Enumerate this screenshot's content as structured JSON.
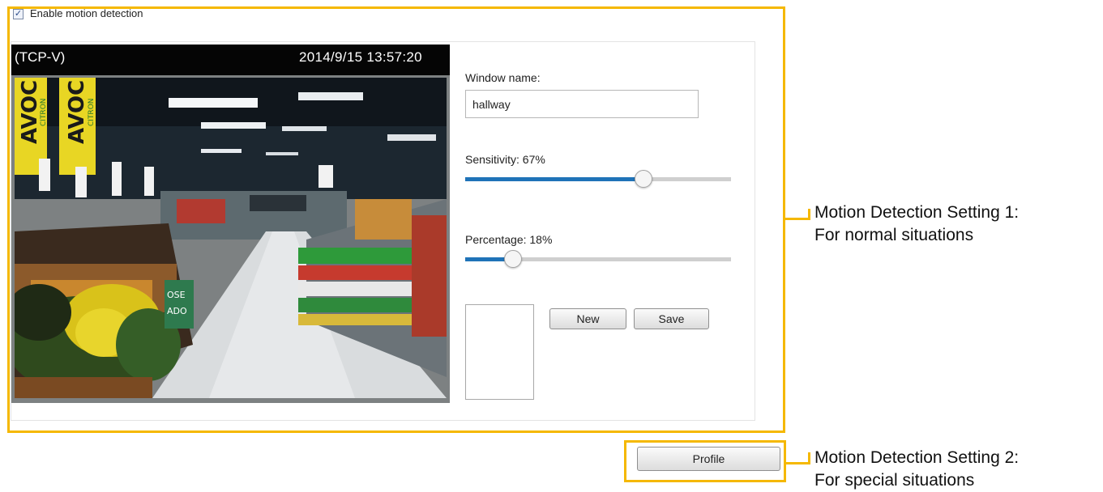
{
  "motion_detection": {
    "enable_checked": true,
    "enable_label": "Enable motion detection",
    "checkbox_mark": "✓"
  },
  "video": {
    "connection_label": "(TCP-V)",
    "timestamp": "2014/9/15 13:57:20",
    "scene_sign_text": "AVOC",
    "scene_sign_sub": "CITRON",
    "scene_small_sign": "OSE ADO"
  },
  "window": {
    "name_label": "Window name:",
    "name_value": "hallway"
  },
  "sensitivity": {
    "label": "Sensitivity: 67%",
    "value_fraction": 0.67
  },
  "percentage": {
    "label": "Percentage: 18%",
    "value_fraction": 0.18
  },
  "buttons": {
    "new_label": "New",
    "save_label": "Save",
    "profile_label": "Profile"
  },
  "callouts": {
    "setting1_line1": "Motion Detection Setting 1:",
    "setting1_line2": "For normal situations",
    "setting2_line1": "Motion Detection Setting 2:",
    "setting2_line2": "For special situations"
  },
  "colors": {
    "highlight": "#f5b800",
    "slider_fill": "#1f73b8",
    "slider_track": "#cfcfcf"
  }
}
